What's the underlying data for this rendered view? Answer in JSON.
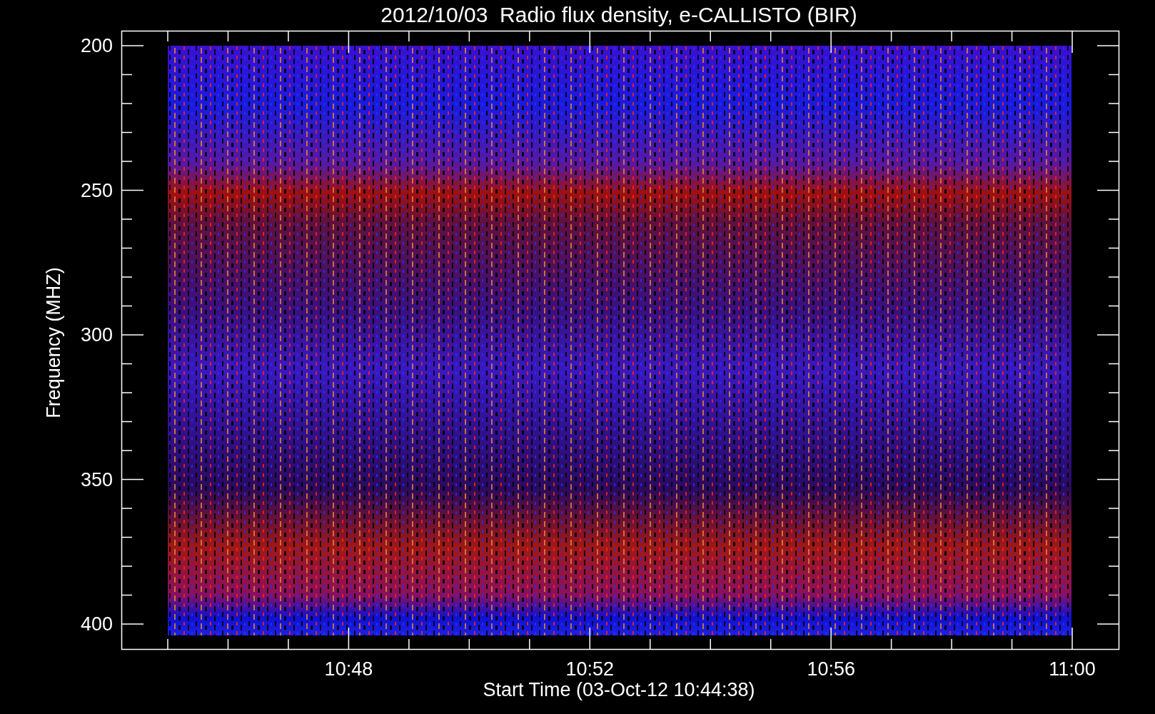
{
  "title": "2012/10/03  Radio flux density, e-CALLISTO (BIR)",
  "y_axis": {
    "label": "Frequency (MHZ)",
    "ticks": [
      "200",
      "250",
      "300",
      "350",
      "400"
    ]
  },
  "x_axis": {
    "label": "Start Time (03-Oct-12 10:44:38)",
    "ticks": [
      "10:48",
      "10:52",
      "10:56",
      "11:00"
    ]
  }
}
